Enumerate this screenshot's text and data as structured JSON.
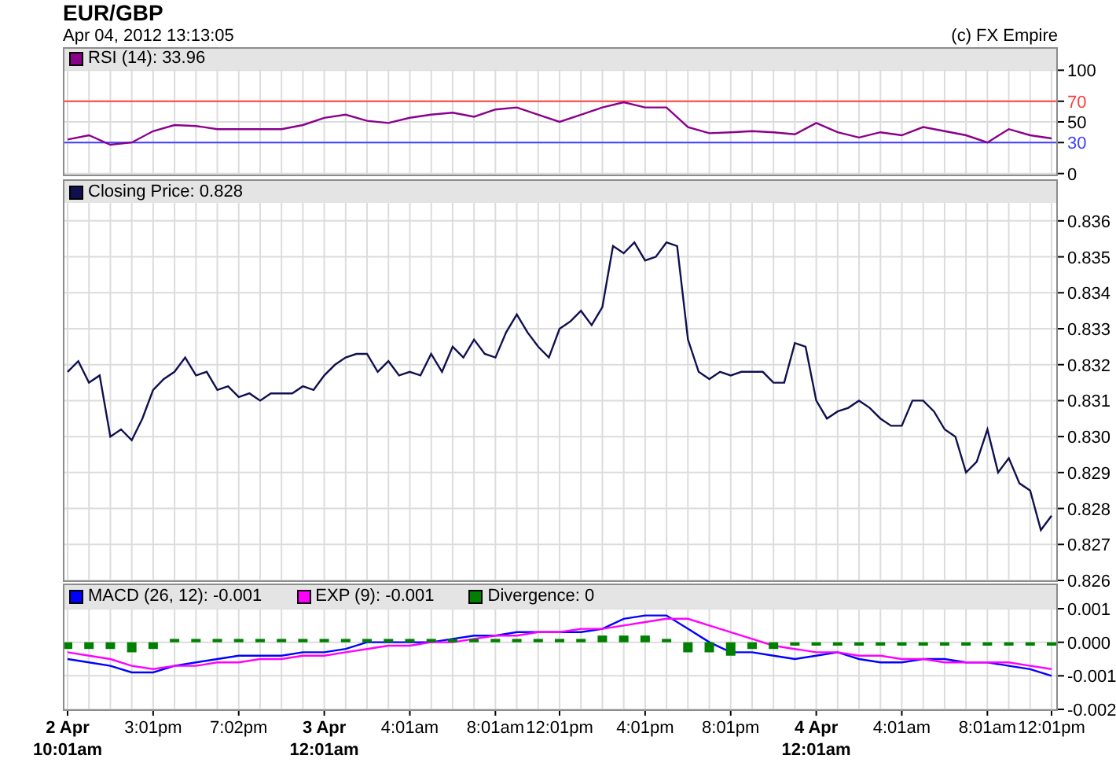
{
  "title": "EUR/GBP",
  "timestamp": "Apr 04, 2012 13:13:05",
  "credit": "(c) FX Empire",
  "rsi_panel": {
    "chart_data": {
      "type": "line",
      "grid": true,
      "legend": "top-left",
      "ylim": [
        -1,
        101
      ],
      "yticks": [
        {
          "value": 100,
          "label": "100"
        },
        {
          "value": 70,
          "label": "70"
        },
        {
          "value": 50,
          "label": "50"
        },
        {
          "value": 30,
          "label": "30"
        },
        {
          "value": 0,
          "label": "0"
        }
      ],
      "ref_lines": [
        {
          "axis": "y",
          "value": 70,
          "color": "#ff4040"
        },
        {
          "axis": "y",
          "value": 30,
          "color": "#4040ff"
        }
      ],
      "series": [
        {
          "name": "RSI (14): 33.96",
          "color": "#8b008b",
          "values": [
            33,
            37,
            28,
            30,
            41,
            47,
            46,
            43,
            43,
            43,
            43,
            47,
            54,
            57,
            51,
            49,
            54,
            57,
            59,
            55,
            62,
            64,
            57,
            50,
            57,
            64,
            69,
            64,
            64,
            45,
            39,
            40,
            41,
            40,
            38,
            49,
            40,
            35,
            40,
            37,
            45,
            41,
            37,
            30,
            43,
            37,
            34
          ]
        }
      ]
    }
  },
  "price_panel": {
    "chart_data": {
      "type": "line",
      "grid": true,
      "legend": "top-left",
      "ylim": [
        0.826,
        0.8365
      ],
      "yticks": [
        {
          "value": 0.836,
          "label": "0.836"
        },
        {
          "value": 0.835,
          "label": "0.835"
        },
        {
          "value": 0.834,
          "label": "0.834"
        },
        {
          "value": 0.833,
          "label": "0.833"
        },
        {
          "value": 0.832,
          "label": "0.832"
        },
        {
          "value": 0.831,
          "label": "0.831"
        },
        {
          "value": 0.83,
          "label": "0.830"
        },
        {
          "value": 0.829,
          "label": "0.829"
        },
        {
          "value": 0.828,
          "label": "0.828"
        },
        {
          "value": 0.827,
          "label": "0.827"
        },
        {
          "value": 0.826,
          "label": "0.826"
        }
      ],
      "series": [
        {
          "name": "Closing Price: 0.828",
          "color": "#101050",
          "values": [
            0.8318,
            0.8321,
            0.8315,
            0.8317,
            0.83,
            0.8302,
            0.8299,
            0.8305,
            0.8313,
            0.8316,
            0.8318,
            0.8322,
            0.8317,
            0.8318,
            0.8313,
            0.8314,
            0.8311,
            0.8312,
            0.831,
            0.8312,
            0.8312,
            0.8312,
            0.8314,
            0.8313,
            0.8317,
            0.832,
            0.8322,
            0.8323,
            0.8323,
            0.8318,
            0.8321,
            0.8317,
            0.8318,
            0.8317,
            0.8323,
            0.8318,
            0.8325,
            0.8322,
            0.8327,
            0.8323,
            0.8322,
            0.8329,
            0.8334,
            0.8329,
            0.8325,
            0.8322,
            0.833,
            0.8332,
            0.8335,
            0.8331,
            0.8336,
            0.8353,
            0.8351,
            0.8354,
            0.8349,
            0.835,
            0.8354,
            0.8353,
            0.8327,
            0.8318,
            0.8316,
            0.8318,
            0.8317,
            0.8318,
            0.8318,
            0.8318,
            0.8315,
            0.8315,
            0.8326,
            0.8325,
            0.831,
            0.8305,
            0.8307,
            0.8308,
            0.831,
            0.8308,
            0.8305,
            0.8303,
            0.8303,
            0.831,
            0.831,
            0.8307,
            0.8302,
            0.83,
            0.829,
            0.8293,
            0.8302,
            0.829,
            0.8294,
            0.8287,
            0.8285,
            0.8274,
            0.8278
          ]
        }
      ]
    }
  },
  "macd_panel": {
    "chart_data": {
      "type": "line",
      "grid": true,
      "legend": "top-left",
      "ylim": [
        -0.002,
        0.001
      ],
      "categories": [
        "2 Apr\n10:01am",
        null,
        null,
        null,
        "3:01pm",
        null,
        null,
        null,
        "7:02pm",
        null,
        null,
        null,
        "3 Apr\n12:01am",
        null,
        null,
        null,
        "4:01am",
        null,
        null,
        null,
        "8:01am",
        null,
        null,
        "12:01pm",
        null,
        null,
        null,
        "4:01pm",
        null,
        null,
        null,
        "8:01pm",
        null,
        null,
        null,
        "4 Apr\n12:01am",
        null,
        null,
        null,
        "4:01am",
        null,
        null,
        null,
        "8:01am",
        null,
        null,
        "12:01pm"
      ],
      "yticks": [
        {
          "value": 0.001,
          "label": "0.001"
        },
        {
          "value": 0,
          "label": "0.000"
        },
        {
          "value": -0.001,
          "label": "-0.001"
        },
        {
          "value": -0.002,
          "label": "-0.002"
        }
      ],
      "series": [
        {
          "name": "MACD (26, 12): -0.001",
          "color": "#0000ff",
          "values": [
            -0.0005,
            -0.0006,
            -0.0007,
            -0.0009,
            -0.0009,
            -0.0007,
            -0.0006,
            -0.0005,
            -0.0004,
            -0.0004,
            -0.0004,
            -0.0003,
            -0.0003,
            -0.0002,
            0.0,
            0.0,
            0.0,
            0.0,
            0.0001,
            0.0002,
            0.0002,
            0.0003,
            0.0003,
            0.0003,
            0.0003,
            0.0004,
            0.0007,
            0.0008,
            0.0008,
            0.0004,
            0.0,
            -0.0003,
            -0.0003,
            -0.0004,
            -0.0005,
            -0.0004,
            -0.0003,
            -0.0005,
            -0.0006,
            -0.0006,
            -0.0005,
            -0.0005,
            -0.0006,
            -0.0006,
            -0.0007,
            -0.0008,
            -0.001
          ]
        },
        {
          "name": "EXP (9): -0.001",
          "color": "#ff00ff",
          "values": [
            -0.0003,
            -0.0004,
            -0.0005,
            -0.0007,
            -0.0008,
            -0.0007,
            -0.0007,
            -0.0006,
            -0.0006,
            -0.0005,
            -0.0005,
            -0.0004,
            -0.0004,
            -0.0003,
            -0.0002,
            -0.0001,
            -0.0001,
            0.0,
            0.0,
            0.0001,
            0.0002,
            0.0002,
            0.0003,
            0.0003,
            0.0004,
            0.0004,
            0.0005,
            0.0006,
            0.0007,
            0.0007,
            0.0005,
            0.0003,
            0.0001,
            -0.0001,
            -0.0002,
            -0.0003,
            -0.0003,
            -0.0004,
            -0.0004,
            -0.0005,
            -0.0005,
            -0.0006,
            -0.0006,
            -0.0006,
            -0.0006,
            -0.0007,
            -0.0008
          ]
        },
        {
          "name": "Divergence: 0",
          "color": "#008000",
          "type": "bar",
          "values": [
            -0.0002,
            -0.0002,
            -0.0002,
            -0.0003,
            -0.0002,
            0.0001,
            0.0001,
            0.0001,
            0.0001,
            0.0001,
            0.0001,
            0.0001,
            0.0001,
            0.0001,
            0.0001,
            0.0001,
            0.0001,
            0.0001,
            0.0001,
            0.0001,
            0.0001,
            0.0001,
            0.0001,
            0.0001,
            0.0001,
            0.0002,
            0.0002,
            0.0002,
            0.0001,
            -0.0003,
            -0.0003,
            -0.0004,
            -0.0002,
            -0.0002,
            -0.0001,
            -0.0001,
            -0.0001,
            -0.0001,
            -0.0001,
            -0.0001,
            -0.0001,
            -0.0001,
            -0.0001,
            -0.0001,
            -0.0001,
            -0.0001,
            -0.0001
          ]
        }
      ]
    }
  }
}
